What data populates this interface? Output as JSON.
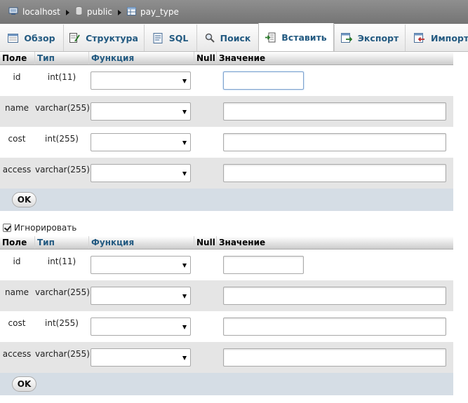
{
  "breadcrumb": {
    "server": "localhost",
    "database": "public",
    "table": "pay_type"
  },
  "tabs": [
    {
      "label": "Обзор",
      "icon": "browse-icon",
      "active": false
    },
    {
      "label": "Структура",
      "icon": "structure-icon",
      "active": false
    },
    {
      "label": "SQL",
      "icon": "sql-icon",
      "active": false
    },
    {
      "label": "Поиск",
      "icon": "search-icon",
      "active": false
    },
    {
      "label": "Вставить",
      "icon": "insert-icon",
      "active": true
    },
    {
      "label": "Экспорт",
      "icon": "export-icon",
      "active": false
    },
    {
      "label": "Импорт",
      "icon": "import-icon",
      "active": false
    }
  ],
  "headers": {
    "field": "Поле",
    "type": "Тип",
    "function": "Функция",
    "null": "Null",
    "value": "Значение"
  },
  "rows1": [
    {
      "name": "id",
      "type": "int(11)",
      "function": "",
      "value": ""
    },
    {
      "name": "name",
      "type": "varchar(255)",
      "function": "",
      "value": ""
    },
    {
      "name": "cost",
      "type": "int(255)",
      "function": "",
      "value": ""
    },
    {
      "name": "access",
      "type": "varchar(255)",
      "function": "",
      "value": ""
    }
  ],
  "rows2": [
    {
      "name": "id",
      "type": "int(11)",
      "function": "",
      "value": ""
    },
    {
      "name": "name",
      "type": "varchar(255)",
      "function": "",
      "value": ""
    },
    {
      "name": "cost",
      "type": "int(255)",
      "function": "",
      "value": ""
    },
    {
      "name": "access",
      "type": "varchar(255)",
      "function": "",
      "value": ""
    }
  ],
  "ok_label": "OK",
  "ignore_label": "Игнорировать",
  "ignore_checked": true
}
